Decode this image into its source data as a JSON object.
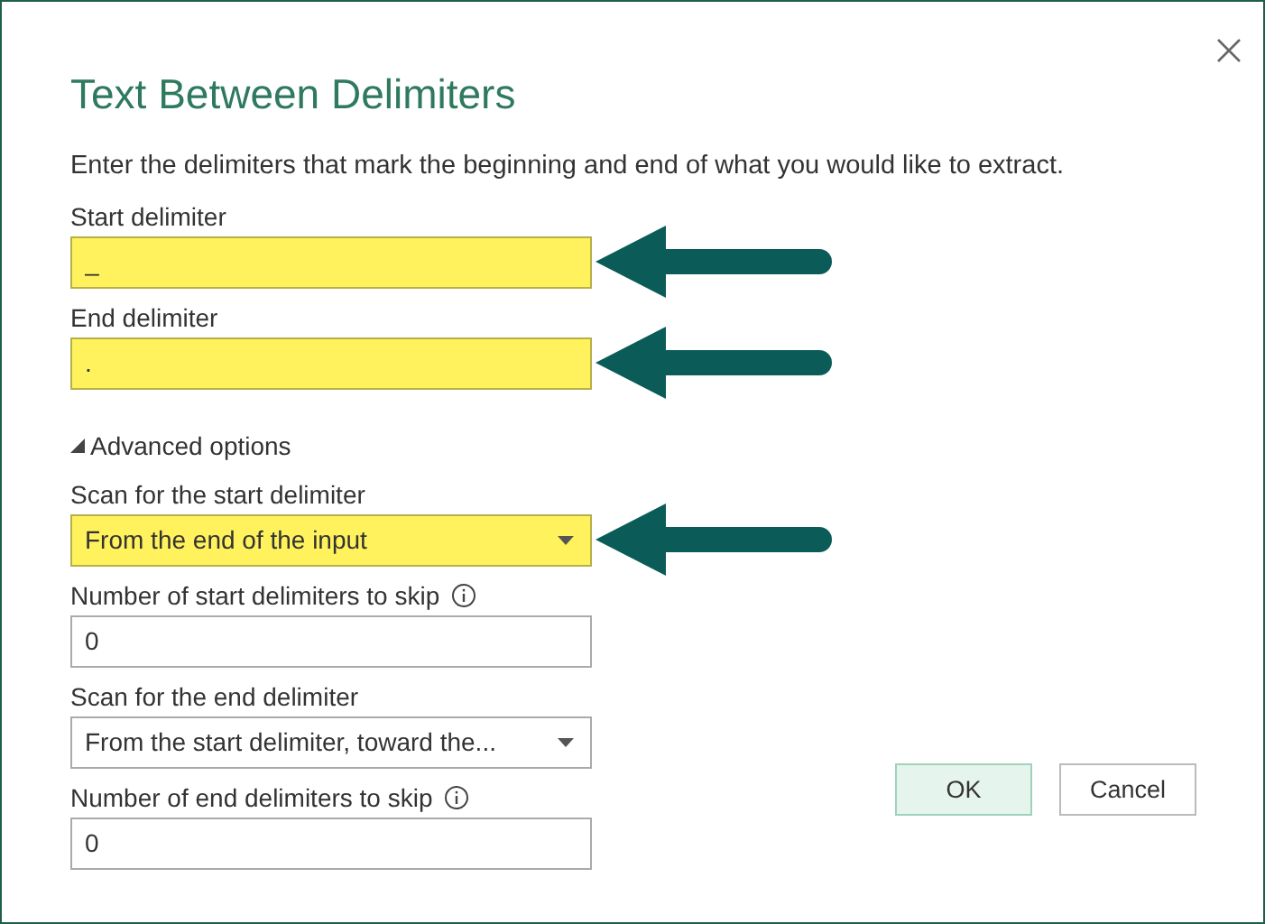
{
  "dialog": {
    "title": "Text Between Delimiters",
    "description": "Enter the delimiters that mark the beginning and end of what you would like to extract.",
    "fields": [
      {
        "label": "Start delimiter",
        "kind": "text",
        "value": "_",
        "highlighted": true,
        "info": false
      },
      {
        "label": "End delimiter",
        "kind": "text",
        "value": ".",
        "highlighted": true,
        "info": false
      }
    ],
    "advanced_options": {
      "label": "Advanced options",
      "expanded": true,
      "fields": [
        {
          "label": "Scan for the start delimiter",
          "kind": "dropdown",
          "value": "From the end of the input",
          "highlighted": true,
          "info": false
        },
        {
          "label": "Number of start delimiters to skip",
          "kind": "text",
          "value": "0",
          "highlighted": false,
          "info": true
        },
        {
          "label": "Scan for the end delimiter",
          "kind": "dropdown",
          "value": "From the start delimiter, toward the...",
          "highlighted": false,
          "info": false
        },
        {
          "label": "Number of end delimiters to skip",
          "kind": "text",
          "value": "0",
          "highlighted": false,
          "info": true
        }
      ]
    },
    "buttons": [
      {
        "label": "OK",
        "default": true
      },
      {
        "label": "Cancel",
        "default": false
      }
    ]
  }
}
